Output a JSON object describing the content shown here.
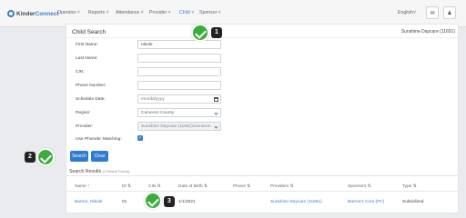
{
  "nav": {
    "logo_a": "Kinder",
    "logo_b": "Connect",
    "items": [
      {
        "label": "Operator ˅"
      },
      {
        "label": "Reports ˅"
      },
      {
        "label": "Attendance ˅"
      },
      {
        "label": "Provider ˅"
      },
      {
        "label": "Child ˅"
      },
      {
        "label": "Sponsor ˅"
      }
    ],
    "language": "English˅",
    "mail_icon": "✉",
    "user_icon": "♟"
  },
  "search": {
    "title": "Child Search",
    "context": "Sunshine Daycare (11651)",
    "fields": [
      {
        "label": "First Name:",
        "value": "nikole",
        "placeholder": ""
      },
      {
        "label": "Last Name:",
        "value": "",
        "placeholder": ""
      },
      {
        "label": "CIN:",
        "value": "",
        "placeholder": ""
      },
      {
        "label": "Phone Number:",
        "value": "",
        "placeholder": ""
      },
      {
        "label": "Schedule Date:",
        "value": "",
        "placeholder": "mm/dd/yyyy"
      },
      {
        "label": "Region:",
        "value": "Cameron County"
      },
      {
        "label": "Provider:",
        "value": "Sunshine Daycare (11651)Cameron"
      },
      {
        "label": "Use Phonetic Matching:",
        "checked": true
      }
    ],
    "search_button": "Search",
    "clear_button": "Clear"
  },
  "results": {
    "title": "Search Results",
    "count": "(1 Result Found)",
    "columns": [
      "Name ↑",
      "ID ⇅",
      "CIN ⇅",
      "Date of Birth ⇅",
      "Phone ⇅",
      "Providers ⇅",
      "Sponsors ⇅",
      "Type ⇅"
    ],
    "rows": [
      {
        "name": "Barron, Nikole",
        "id": "01",
        "cin": "",
        "dob": "1/1/2021",
        "phone": "",
        "provider": "Sunshine Daycare (11651)",
        "sponsor": "Barron's Cont (PC)",
        "type": "Subsidized"
      }
    ]
  },
  "steps": [
    "1",
    "2",
    "3"
  ],
  "colors": {
    "accent": "#2f7bd0",
    "check_green": "#3aad3e",
    "step_bg": "#222222"
  }
}
